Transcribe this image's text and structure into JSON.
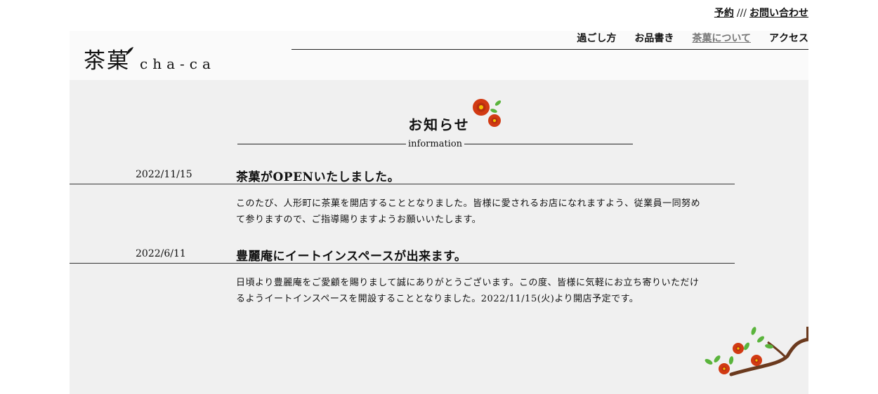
{
  "top_links": {
    "reserve": "予約",
    "separator": "///",
    "contact": "お問い合わせ"
  },
  "logo": {
    "kanji": "茶菓",
    "roman": "cha-ca"
  },
  "nav": [
    {
      "label": "過ごし方"
    },
    {
      "label": "お品書き"
    },
    {
      "label": "茶菓について"
    },
    {
      "label": "アクセス"
    }
  ],
  "section": {
    "title": "お知らせ",
    "subtitle": "information"
  },
  "news": [
    {
      "date": "2022/11/15",
      "title": "茶菓がOPENいたしました。",
      "body": "このたび、人形町に茶菓を開店することとなりました。皆様に愛されるお店になれますよう、従業員一同努めて参りますので、ご指導賜りますようお願いいたします。"
    },
    {
      "date": "2022/6/11",
      "title": "豊麗庵にイートインスペースが出来ます。",
      "body": "日頃より豊麗庵をご愛顧を賜りまして誠にありがとうございます。この度、皆様に気軽にお立ち寄りいただけるようイートインスペースを開設することとなりました。2022/11/15(火)より開店予定です。"
    }
  ],
  "colors": {
    "flower": "#d23a13",
    "leaf": "#5ab43c",
    "branch": "#6b3a1e",
    "content_bg": "#f0f0f0"
  }
}
